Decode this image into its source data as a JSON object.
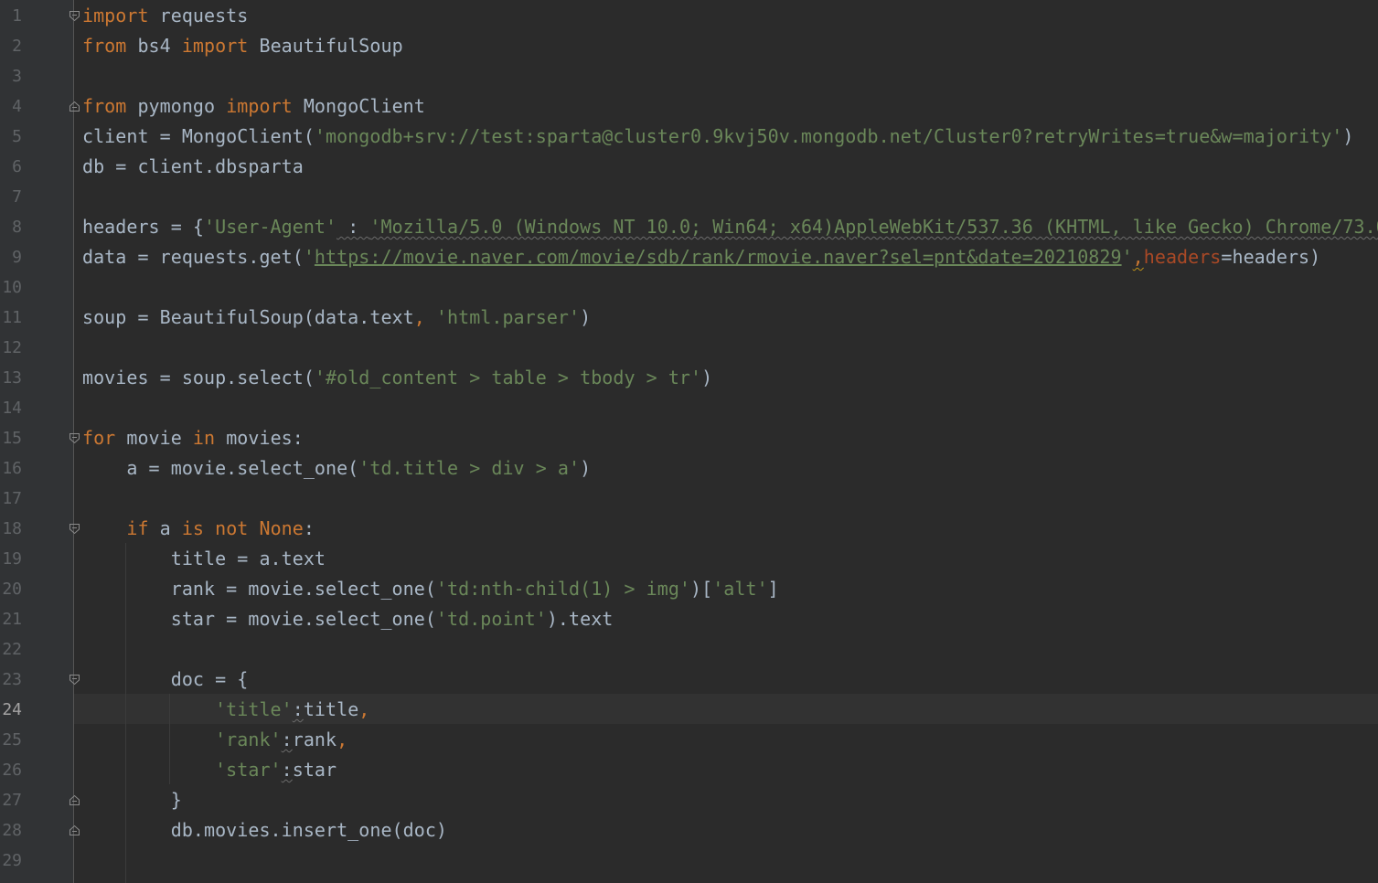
{
  "editor": {
    "language": "python",
    "active_line": 24,
    "colors": {
      "background": "#2b2b2b",
      "gutter": "#313335",
      "caret_line": "#323232",
      "line_number": "#606366",
      "default_text": "#a9b7c6",
      "keyword": "#cc7832",
      "string": "#6a8759",
      "named_param": "#aa4926"
    }
  },
  "line_numbers": [
    "1",
    "2",
    "3",
    "4",
    "5",
    "6",
    "7",
    "8",
    "9",
    "10",
    "11",
    "12",
    "13",
    "14",
    "15",
    "16",
    "17",
    "18",
    "19",
    "20",
    "21",
    "22",
    "23",
    "24",
    "25",
    "26",
    "27",
    "28",
    "29"
  ],
  "code": {
    "l1": {
      "kw_import": "import",
      "rest": " requests"
    },
    "l2": {
      "kw_from": "from",
      "mod": " bs4 ",
      "kw_import": "import",
      "rest": " BeautifulSoup"
    },
    "l4": {
      "kw_from": "from",
      "mod": " pymongo ",
      "kw_import": "import",
      "rest": " MongoClient"
    },
    "l5": {
      "pre": "client = MongoClient(",
      "str": "'mongodb+srv://test:sparta@cluster0.9kvj50v.mongodb.net/Cluster0?retryWrites=true&w=majority'",
      "post": ")"
    },
    "l6": {
      "text": "db = client.dbsparta"
    },
    "l8": {
      "pre": "headers = {",
      "key": "'User-Agent'",
      "colon": " : ",
      "val": "'Mozilla/5.0 (Windows NT 10.0; Win64; x64)AppleWebKit/537.36 (KHTML, like Gecko) Chrome/73.0"
    },
    "l9": {
      "pre": "data = requests.get(",
      "q1": "'",
      "url": "https://movie.naver.com/movie/sdb/rank/rmovie.naver?sel=pnt&date=20210829",
      "q2": "'",
      "comma": ",",
      "param": "headers",
      "post": "=headers)"
    },
    "l11": {
      "pre": "soup = BeautifulSoup(data.text",
      "comma": ",",
      "sp": " ",
      "str": "'html.parser'",
      "post": ")"
    },
    "l13": {
      "pre": "movies = soup.select(",
      "str": "'#old_content > table > tbody > tr'",
      "post": ")"
    },
    "l15": {
      "kw_for": "for",
      "mid": " movie ",
      "kw_in": "in",
      "post": " movies:"
    },
    "l16": {
      "pre": "    a = movie.select_one(",
      "str": "'td.title > div > a'",
      "post": ")"
    },
    "l18": {
      "indent": "    ",
      "kw_if": "if",
      "mid": " a ",
      "kw_is": "is",
      "sp1": " ",
      "kw_not": "not",
      "sp2": " ",
      "kw_none": "None",
      "post": ":"
    },
    "l19": {
      "text": "        title = a.text"
    },
    "l20": {
      "pre": "        rank = movie.select_one(",
      "str": "'td:nth-child(1) > img'",
      "mid": ")[",
      "str2": "'alt'",
      "post": "]"
    },
    "l21": {
      "pre": "        star = movie.select_one(",
      "str": "'td.point'",
      "post": ").text"
    },
    "l23": {
      "text": "        doc = {"
    },
    "l24": {
      "indent": "            ",
      "key": "'title'",
      "colon": ":",
      "val": "title",
      "comma": ","
    },
    "l25": {
      "indent": "            ",
      "key": "'rank'",
      "colon": ":",
      "val": "rank",
      "comma": ","
    },
    "l26": {
      "indent": "            ",
      "key": "'star'",
      "colon": ":",
      "val": "star"
    },
    "l27": {
      "text": "        }"
    },
    "l28": {
      "text": "        db.movies.insert_one(doc)"
    }
  }
}
